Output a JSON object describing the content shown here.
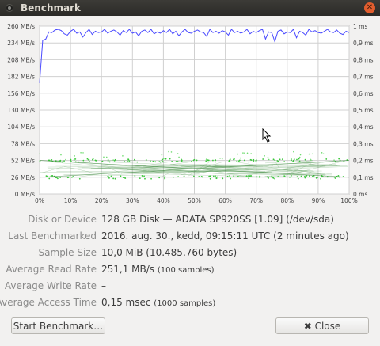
{
  "window": {
    "title": "Benchmark"
  },
  "chart_data": {
    "type": "line",
    "left_axis": {
      "ticks": [
        "260 MB/s",
        "234 MB/s",
        "208 MB/s",
        "182 MB/s",
        "156 MB/s",
        "130 MB/s",
        "104 MB/s",
        "78 MB/s",
        "52 MB/s",
        "26 MB/s",
        "0 MB/s"
      ],
      "ylim": [
        0,
        260
      ]
    },
    "right_axis": {
      "ticks": [
        "1 ms",
        "0,9 ms",
        "0,8 ms",
        "0,7 ms",
        "0,6 ms",
        "0,5 ms",
        "0,4 ms",
        "0,3 ms",
        "0,2 ms",
        "0,1 ms",
        "0 ms"
      ],
      "ylim": [
        0,
        1
      ]
    },
    "x_axis": {
      "ticks": [
        "0%",
        "10%",
        "20%",
        "30%",
        "40%",
        "50%",
        "60%",
        "70%",
        "80%",
        "90%",
        "100%"
      ],
      "xlim": [
        0,
        100
      ]
    },
    "grid": true,
    "series": [
      {
        "color": "#4a4aff",
        "x": [
          0,
          1,
          2,
          3,
          4,
          5,
          6,
          7,
          8,
          9,
          10,
          11,
          12,
          13,
          14,
          15,
          16,
          17,
          18,
          19,
          20,
          21,
          22,
          23,
          24,
          25,
          26,
          27,
          28,
          29,
          30,
          31,
          32,
          33,
          34,
          35,
          36,
          37,
          38,
          39,
          40,
          41,
          42,
          43,
          44,
          45,
          46,
          47,
          48,
          49,
          50,
          51,
          52,
          53,
          54,
          55,
          56,
          57,
          58,
          59,
          60,
          61,
          62,
          63,
          64,
          65,
          66,
          67,
          68,
          69,
          70,
          71,
          72,
          73,
          74,
          75,
          76,
          77,
          78,
          79,
          80,
          81,
          82,
          83,
          84,
          85,
          86,
          87,
          88,
          89,
          90,
          91,
          92,
          93,
          94,
          95,
          96,
          97,
          98,
          99,
          100
        ],
        "values": [
          172,
          238,
          240,
          251,
          250,
          254,
          255,
          253,
          248,
          246,
          252,
          255,
          249,
          251,
          243,
          250,
          255,
          247,
          252,
          250,
          251,
          255,
          249,
          252,
          254,
          251,
          246,
          253,
          250,
          255,
          249,
          251,
          245,
          252,
          254,
          250,
          255,
          248,
          251,
          249,
          253,
          250,
          255,
          248,
          252,
          245,
          251,
          255,
          250,
          249,
          252,
          254,
          251,
          250,
          244,
          255,
          250,
          252,
          249,
          253,
          251,
          246,
          255,
          250,
          252,
          249,
          251,
          255,
          248,
          252,
          250,
          253,
          255,
          240,
          251,
          250,
          236,
          252,
          254,
          248,
          251,
          250,
          255,
          242,
          252,
          250,
          246,
          255,
          251,
          253,
          250,
          249,
          252,
          255,
          251,
          250,
          254,
          249,
          247,
          252,
          250
        ]
      },
      {
        "color": "#3cc83c",
        "x": [
          0,
          100
        ],
        "values": [
          52,
          26
        ]
      },
      {
        "color": "#3cc83c",
        "x": [
          0,
          100
        ],
        "values": [
          26,
          52
        ]
      }
    ]
  },
  "info": [
    {
      "label": "Disk or Device",
      "value": "128 GB Disk — ADATA SP920SS [1.09] (/dev/sda)",
      "note": ""
    },
    {
      "label": "Last Benchmarked",
      "value": "2016. aug. 30., kedd, 09:15:11 UTC (2 minutes ago)",
      "note": ""
    },
    {
      "label": "Sample Size",
      "value": "10,0 MiB (10.485.760 bytes)",
      "note": ""
    },
    {
      "label": "Average Read Rate",
      "value": "251,1 MB/s",
      "note": "(100 samples)"
    },
    {
      "label": "Average Write Rate",
      "value": "–",
      "note": ""
    },
    {
      "label": "Average Access Time",
      "value": "0,15 msec",
      "note": "(1000 samples)"
    }
  ],
  "buttons": {
    "start": "Start Benchmark…",
    "close": "Close"
  }
}
